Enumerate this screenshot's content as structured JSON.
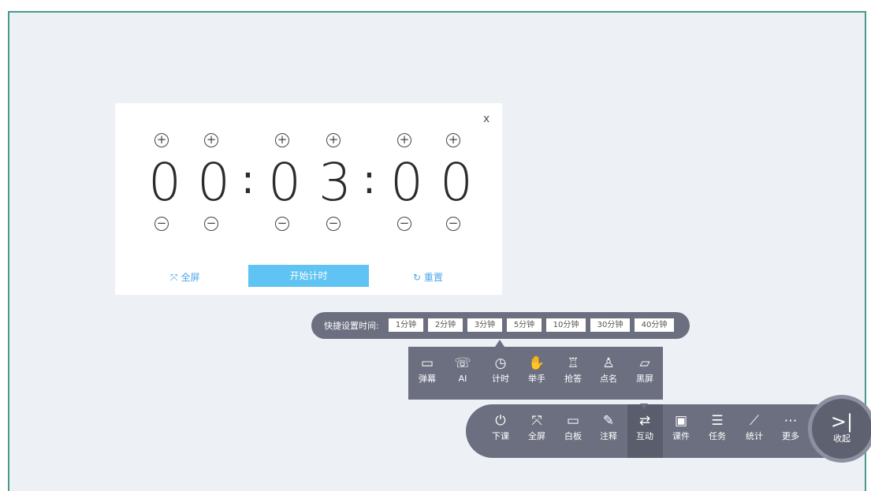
{
  "timer": {
    "digits": [
      "0",
      "0",
      "0",
      "3",
      "0",
      "0"
    ],
    "colon": ":",
    "plus": "+",
    "minus": "−",
    "close": "x",
    "fullscreen_label": "全屏",
    "fullscreen_icon": "⤧",
    "start_label": "开始计时",
    "reset_label": "重置",
    "reset_icon": "↻"
  },
  "quick": {
    "label": "快捷设置时间:",
    "options": [
      "1分钟",
      "2分钟",
      "3分钟",
      "5分钟",
      "10分钟",
      "30分钟",
      "40分钟"
    ]
  },
  "interaction": {
    "tools": [
      {
        "label": "弹幕",
        "icon": "▭"
      },
      {
        "label": "AI",
        "icon": "☏"
      },
      {
        "label": "计时",
        "icon": "◷"
      },
      {
        "label": "举手",
        "icon": "✋"
      },
      {
        "label": "抢答",
        "icon": "♖"
      },
      {
        "label": "点名",
        "icon": "♙"
      },
      {
        "label": "黑屏",
        "icon": "▱"
      }
    ]
  },
  "toolbar": {
    "tools": [
      {
        "label": "下课",
        "icon": "⏻"
      },
      {
        "label": "全屏",
        "icon": "⤧"
      },
      {
        "label": "白板",
        "icon": "▭"
      },
      {
        "label": "注释",
        "icon": "✎"
      },
      {
        "label": "互动",
        "icon": "⇄"
      },
      {
        "label": "课件",
        "icon": "▣"
      },
      {
        "label": "任务",
        "icon": "☰"
      },
      {
        "label": "统计",
        "icon": "⟋"
      },
      {
        "label": "更多",
        "icon": "⋯"
      }
    ],
    "collapse_label": "收起",
    "collapse_icon": ">|"
  }
}
